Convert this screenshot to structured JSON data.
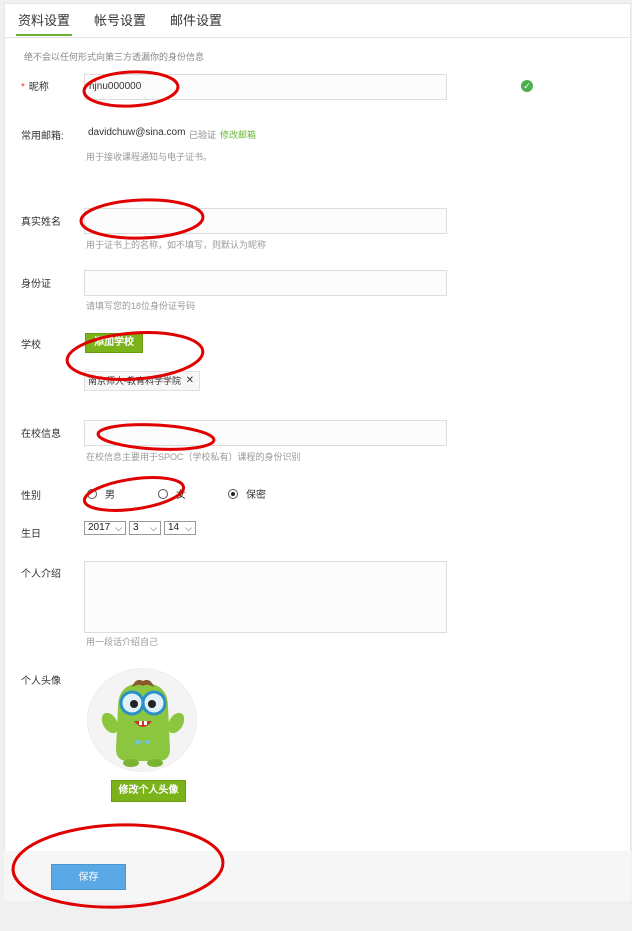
{
  "tabs": [
    {
      "label": "资料设置"
    },
    {
      "label": "帐号设置"
    },
    {
      "label": "邮件设置"
    }
  ],
  "notice": "绝不会以任何形式向第三方透漏你的身份信息",
  "nickname": {
    "required_mark": "*",
    "label": "昵称",
    "value": "njnu000000"
  },
  "email": {
    "label": "常用邮箱:",
    "value": "davidchuw@sina.com",
    "status": "已验证",
    "change_link": "修改邮箱",
    "hint": "用于接收课程通知与电子证书。"
  },
  "real_name": {
    "label": "真实姓名",
    "value": "",
    "hint": "用于证书上的名称，如不填写，则默认为昵称"
  },
  "id_card": {
    "label": "身份证",
    "value": "",
    "hint": "请填写您的18位身份证号码"
  },
  "school": {
    "label": "学校",
    "add_button": "添加学校",
    "selected": "南京师大-教育科学学院",
    "remove_symbol": "✕"
  },
  "campus_info": {
    "label": "在校信息",
    "value": "",
    "hint": "在校信息主要用于SPOC（学校私有）课程的身份识别"
  },
  "gender": {
    "label": "性别",
    "options": [
      "男",
      "女",
      "保密"
    ],
    "selected": "保密"
  },
  "birthday": {
    "label": "生日",
    "year": "2017",
    "month": "3",
    "day": "14"
  },
  "bio": {
    "label": "个人介绍",
    "value": "",
    "hint": "用一段话介绍自己"
  },
  "avatar": {
    "label": "个人头像",
    "change_button": "修改个人头像"
  },
  "save_label": "保存",
  "colors": {
    "accent": "#7bb31a",
    "save": "#5aa9e6",
    "annotation": "#e00000"
  },
  "icons": {
    "verified": "check-circle-icon",
    "select_arrow": "chevron-down-icon"
  }
}
